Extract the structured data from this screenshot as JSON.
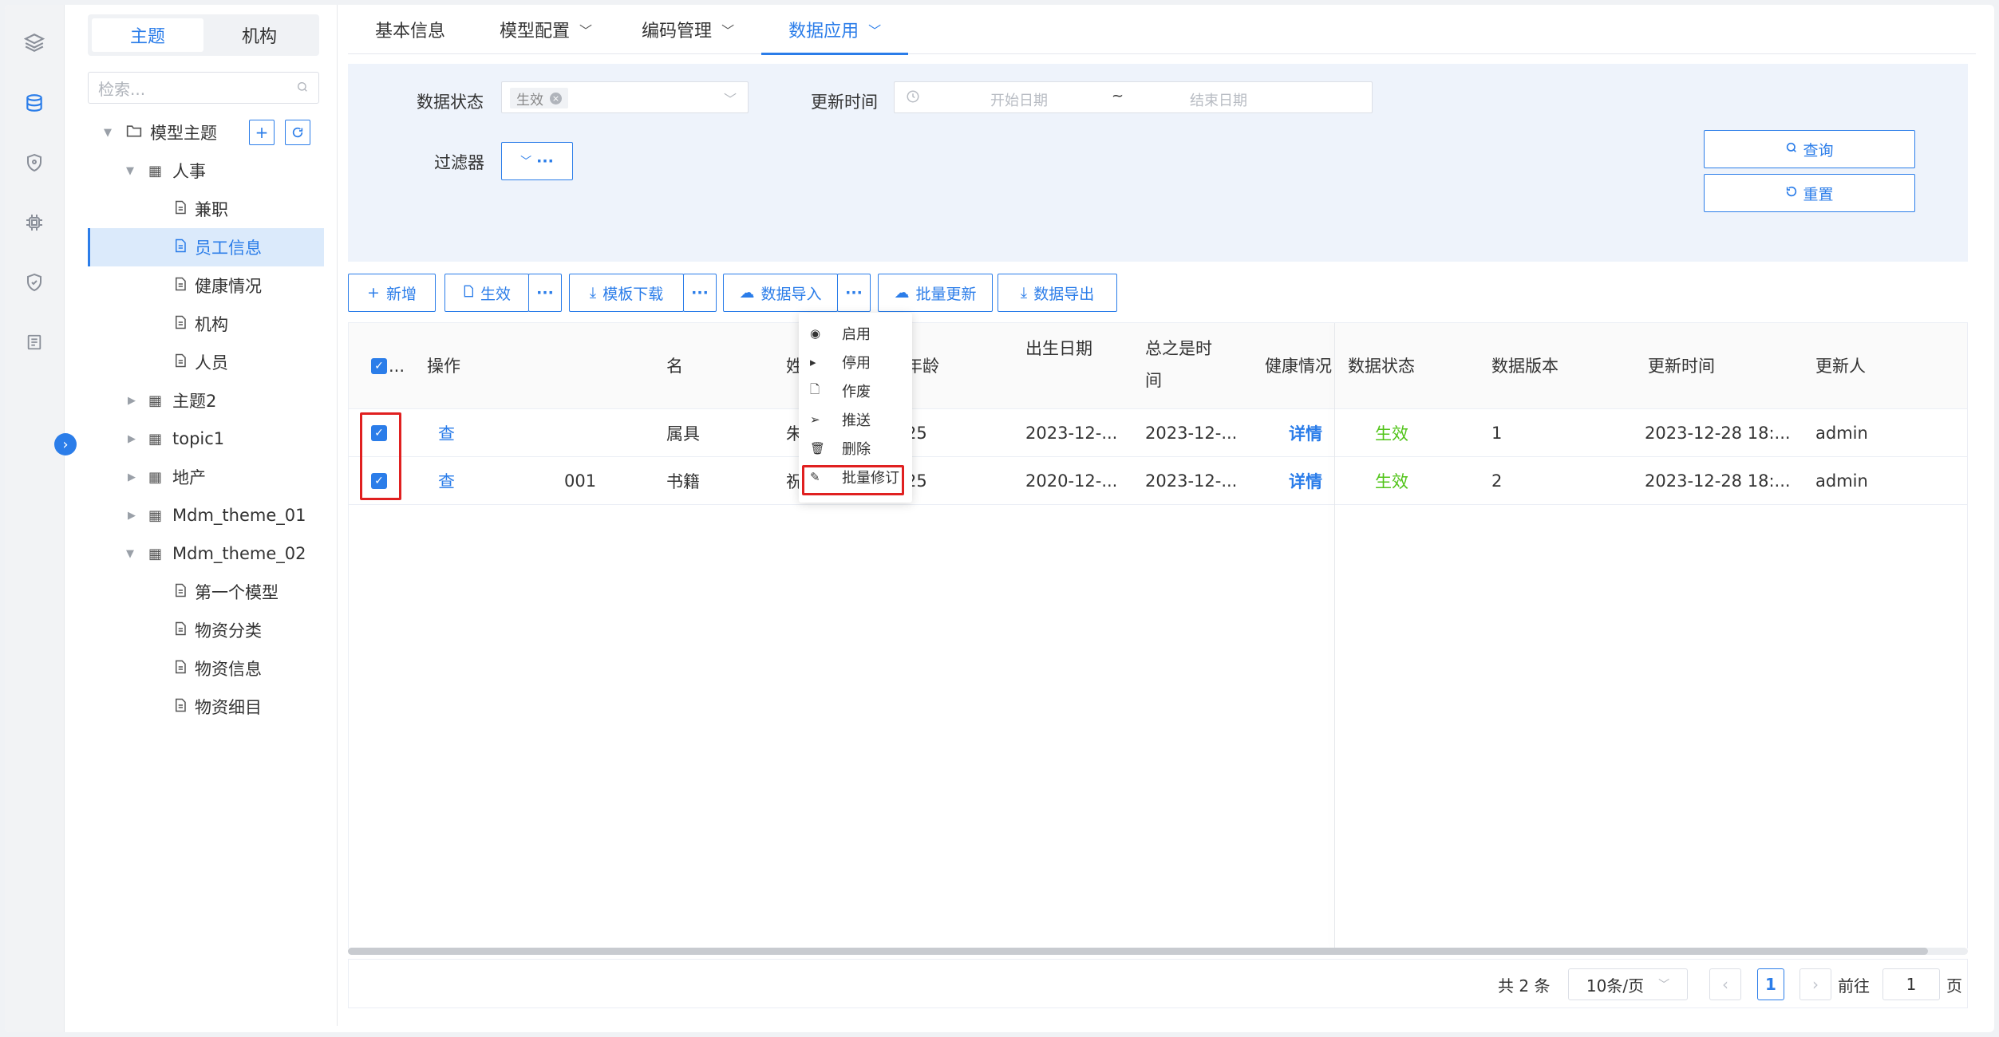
{
  "tree_panel": {
    "segments": [
      "主题",
      "机构"
    ],
    "search_placeholder": "检索...",
    "root": "模型主题",
    "nodes": [
      "人事",
      "兼职",
      "员工信息",
      "健康情况",
      "机构",
      "人员",
      "主题2",
      "topic1",
      "地产",
      "Mdm_theme_01",
      "Mdm_theme_02",
      "第一个模型",
      "物资分类",
      "物资信息",
      "物资细目"
    ]
  },
  "tabs": [
    "基本信息",
    "模型配置",
    "编码管理",
    "数据应用"
  ],
  "filter": {
    "status_label": "数据状态",
    "status_value": "生效",
    "time_label": "更新时间",
    "start_placeholder": "开始日期",
    "range_sep": "~",
    "end_placeholder": "结束日期",
    "filter_label": "过滤器",
    "query": "查询",
    "reset": "重置"
  },
  "toolbar": {
    "add": "新增",
    "effective": "生效",
    "template": "模板下载",
    "import": "数据导入",
    "batch_update": "批量更新",
    "export": "数据导出",
    "more": "···"
  },
  "menu": [
    "启用",
    "停用",
    "作废",
    "推送",
    "删除",
    "批量修订"
  ],
  "table": {
    "headers": {
      "select": "...",
      "op": "操作",
      "ming": "名",
      "xing": "姓",
      "age": "年龄",
      "birth": "出生日期",
      "zongzhi_1": "总之是时",
      "zongzhi_2": "间",
      "health": "健康情况",
      "status": "数据状态",
      "version": "数据版本",
      "updated": "更新时间",
      "updater": "更新人"
    },
    "rows": [
      {
        "op": "查",
        "code": "",
        "ming": "属具",
        "xing": "朱",
        "age": "25",
        "birth": "2023-12-...",
        "zongzhi": "2023-12-...",
        "health": "详情",
        "status": "生效",
        "version": "1",
        "updated": "2023-12-28 18:...",
        "updater": "admin"
      },
      {
        "op": "查",
        "code": "001",
        "ming": "书籍",
        "xing": "祝",
        "age": "25",
        "birth": "2020-12-...",
        "zongzhi": "2023-12-...",
        "health": "详情",
        "status": "生效",
        "version": "2",
        "updated": "2023-12-28 18:...",
        "updater": "admin"
      }
    ]
  },
  "pager": {
    "total": "共 2 条",
    "page_size": "10条/页",
    "prev": "‹",
    "current": "1",
    "next": "›",
    "goto": "前往",
    "goto_value": "1",
    "page_suffix": "页"
  }
}
